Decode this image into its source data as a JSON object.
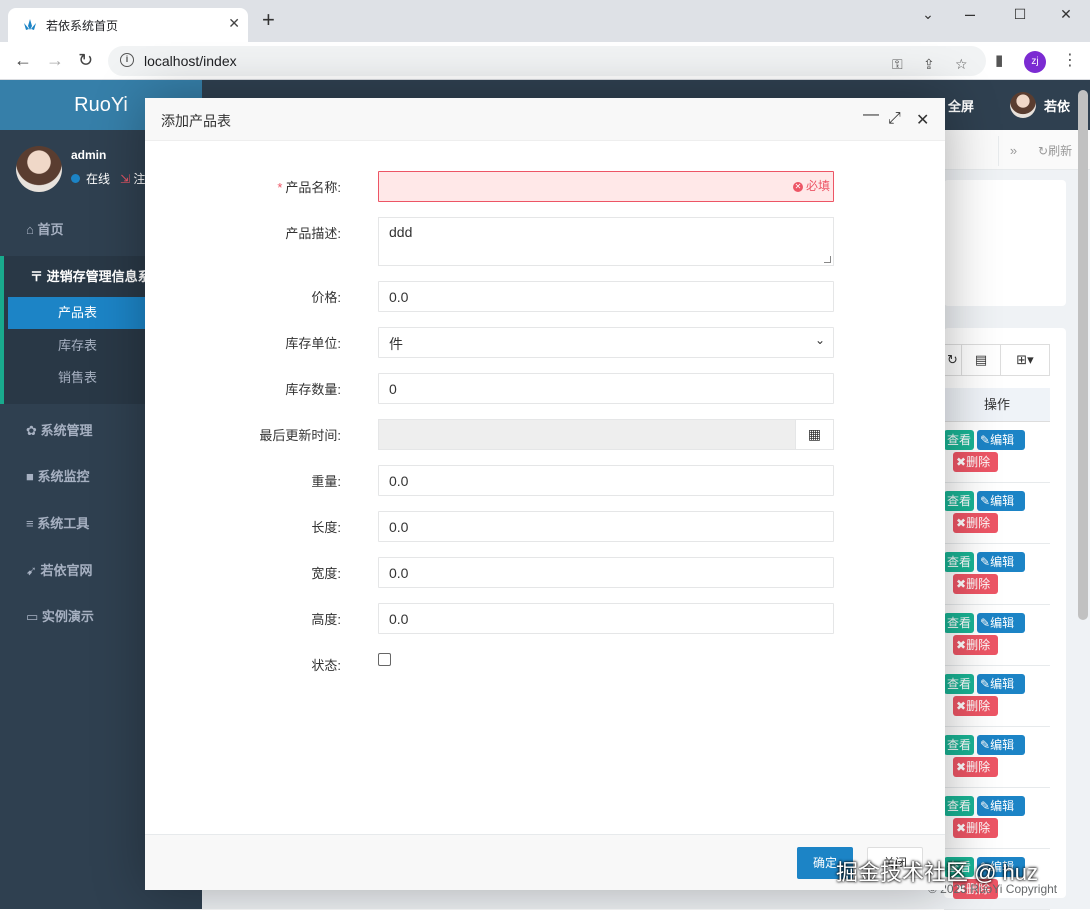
{
  "browser": {
    "tab_title": "若依系统首页",
    "url": "localhost/index",
    "profile_initials": "zj"
  },
  "sidebar": {
    "logo": "RuoYi",
    "user_name": "admin",
    "user_status": "在线",
    "logout_label": "注",
    "items": [
      {
        "label": "首页",
        "icon": "home-icon"
      },
      {
        "label": "系统管理",
        "icon": "gear-icon"
      },
      {
        "label": "系统监控",
        "icon": "video-icon"
      },
      {
        "label": "系统工具",
        "icon": "bars-icon"
      },
      {
        "label": "若依官网",
        "icon": "location-arrow-icon"
      },
      {
        "label": "实例演示",
        "icon": "desktop-icon"
      }
    ],
    "group": {
      "title": "进销存管理信息系",
      "sub_items": [
        "产品表",
        "库存表",
        "销售表"
      ]
    }
  },
  "topnav": {
    "fullscreen_label": "全屏",
    "user_label": "若依",
    "refresh_label": "刷新"
  },
  "table": {
    "operation_header": "操作",
    "view_label": "查看",
    "edit_label": "编辑",
    "delete_label": "删除"
  },
  "footer": {
    "copyright": "© 2025 RuoYi Copyright",
    "watermark": "掘金技术社区 @ huz"
  },
  "modal": {
    "title": "添加产品表",
    "fields": {
      "name_label": "产品名称:",
      "name_value": "",
      "name_error": "必填",
      "desc_label": "产品描述:",
      "desc_value": "ddd",
      "price_label": "价格:",
      "price_value": "0.0",
      "unit_label": "库存单位:",
      "unit_value": "件",
      "qty_label": "库存数量:",
      "qty_value": "0",
      "updated_label": "最后更新时间:",
      "updated_value": "",
      "weight_label": "重量:",
      "weight_value": "0.0",
      "length_label": "长度:",
      "length_value": "0.0",
      "width_label": "宽度:",
      "width_value": "0.0",
      "height_label": "高度:",
      "height_value": "0.0",
      "status_label": "状态:"
    },
    "buttons": {
      "ok": "确定",
      "cancel": "关闭"
    }
  },
  "colors": {
    "primary": "#1c84c6",
    "success": "#1ab394",
    "danger": "#ed5565",
    "sidebar_bg": "#2f4050"
  }
}
